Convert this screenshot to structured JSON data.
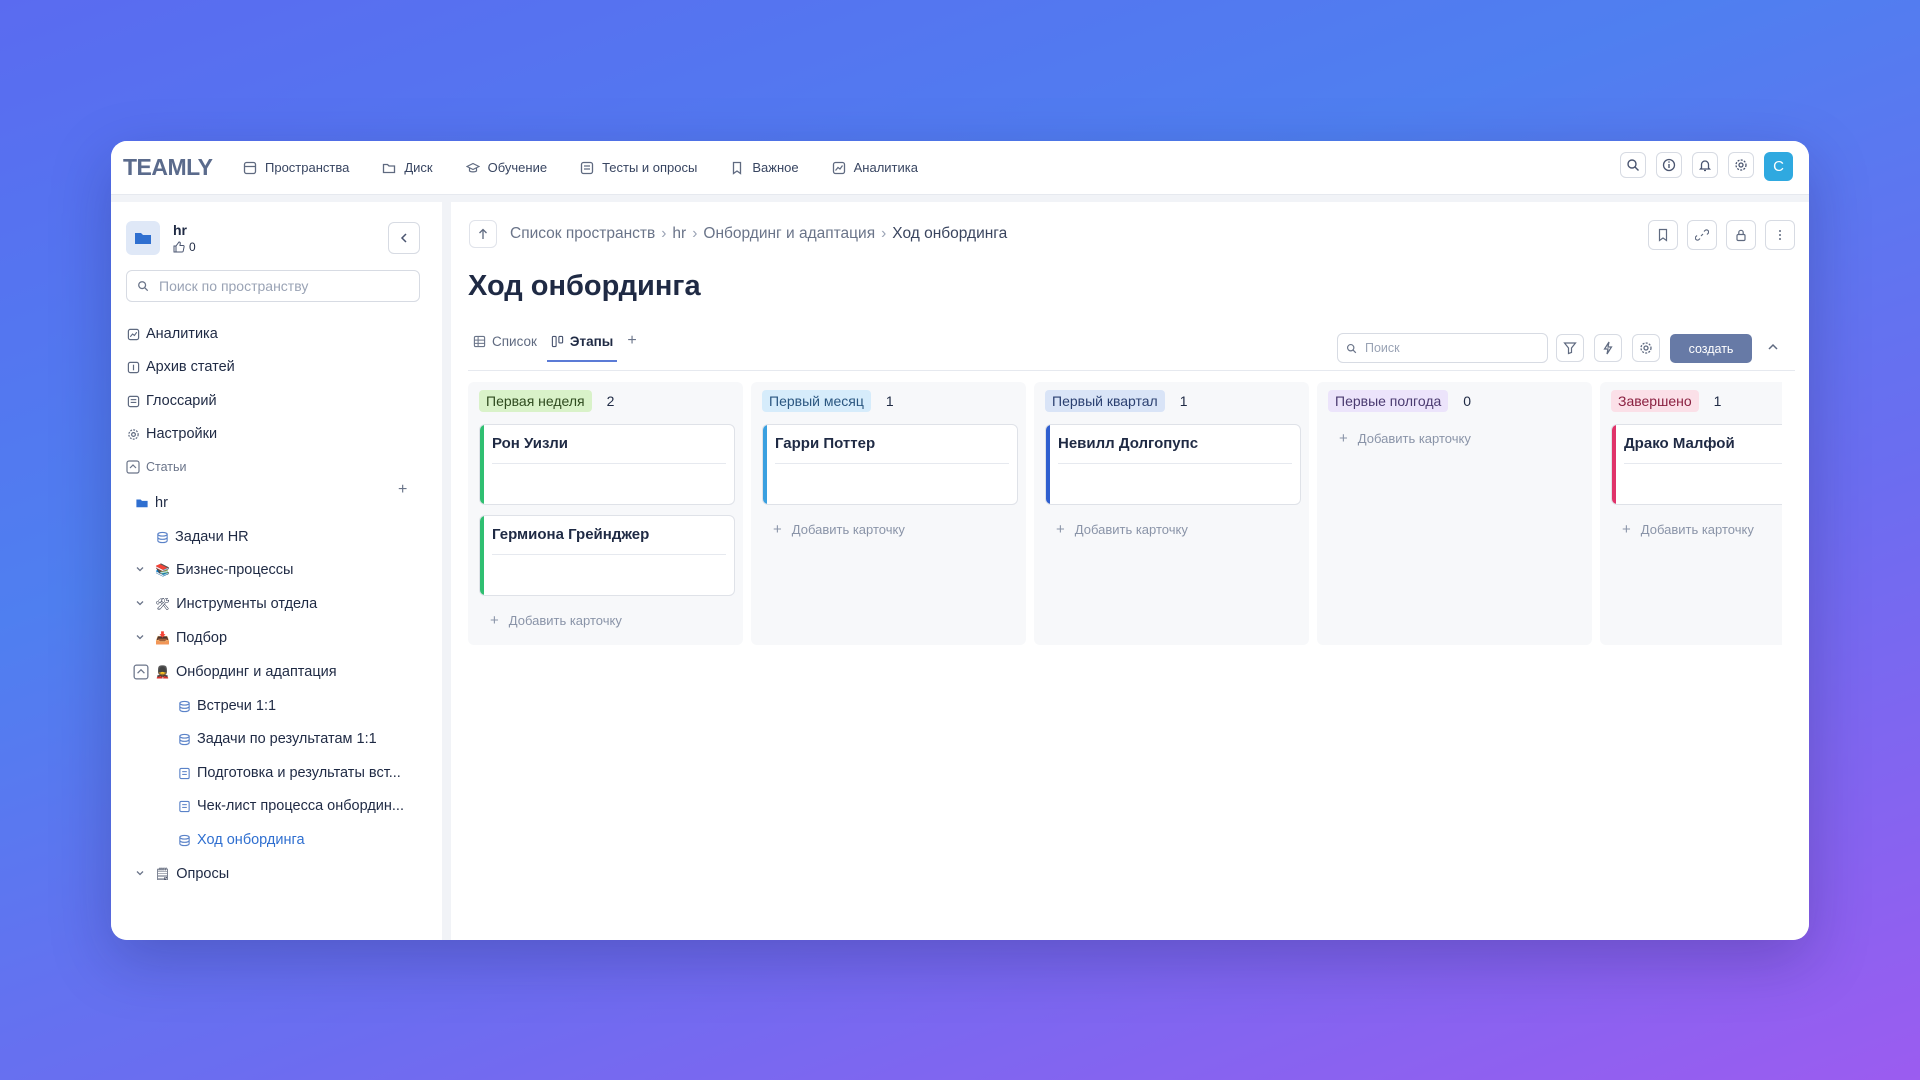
{
  "app": {
    "logo": "TEAMLY",
    "nav": [
      {
        "label": "Пространства",
        "icon": "spaces-icon"
      },
      {
        "label": "Диск",
        "icon": "folder-icon"
      },
      {
        "label": "Обучение",
        "icon": "graduation-icon"
      },
      {
        "label": "Тесты и опросы",
        "icon": "tests-icon"
      },
      {
        "label": "Важное",
        "icon": "bookmark-icon"
      },
      {
        "label": "Аналитика",
        "icon": "analytics-icon"
      }
    ],
    "user_initial": "C"
  },
  "sidebar": {
    "space_name": "hr",
    "likes": "0",
    "search_placeholder": "Поиск по пространству",
    "menu": [
      {
        "label": "Аналитика"
      },
      {
        "label": "Архив статей"
      },
      {
        "label": "Глоссарий"
      },
      {
        "label": "Настройки"
      }
    ],
    "section_label": "Статьи",
    "tree": [
      {
        "label": "hr"
      },
      {
        "label": "Задачи HR"
      },
      {
        "label": "Бизнес-процессы"
      },
      {
        "label": "Инструменты отдела"
      },
      {
        "label": "Подбор"
      },
      {
        "label": "Онбординг и адаптация"
      },
      {
        "label": "Встречи 1:1"
      },
      {
        "label": "Задачи по результатам 1:1"
      },
      {
        "label": "Подготовка и результаты вст..."
      },
      {
        "label": "Чек-лист процесса онбордин..."
      },
      {
        "label": "Ход онбординга"
      },
      {
        "label": "Опросы"
      }
    ]
  },
  "main": {
    "breadcrumb": [
      "Список пространств",
      "hr",
      "Онбординг и адаптация",
      "Ход онбординга"
    ],
    "title": "Ход онбординга",
    "tabs": [
      {
        "label": "Список"
      },
      {
        "label": "Этапы"
      }
    ],
    "search_placeholder": "Поиск",
    "create_label": "создать",
    "add_card_label": "Добавить карточку"
  },
  "board": {
    "columns": [
      {
        "name": "Первая неделя",
        "count": "2",
        "badge_bg": "#d9f2c9",
        "badge_fg": "#2e4a1e",
        "accent": "#2fbf71",
        "cards": [
          {
            "title": "Рон Уизли"
          },
          {
            "title": "Гермиона Грейнджер"
          }
        ]
      },
      {
        "name": "Первый месяц",
        "count": "1",
        "badge_bg": "#d6ecfb",
        "badge_fg": "#2a5680",
        "accent": "#3aa0e0",
        "cards": [
          {
            "title": "Гарри Поттер"
          }
        ]
      },
      {
        "name": "Первый квартал",
        "count": "1",
        "badge_bg": "#d9e4f7",
        "badge_fg": "#2a3f70",
        "accent": "#2f5fcf",
        "cards": [
          {
            "title": "Невилл Долгопупс"
          }
        ]
      },
      {
        "name": "Первые полгода",
        "count": "0",
        "badge_bg": "#ece4fb",
        "badge_fg": "#4a3a70",
        "accent": "#8a6fe0",
        "cards": []
      },
      {
        "name": "Завершено",
        "count": "1",
        "badge_bg": "#fbe0e8",
        "badge_fg": "#8a2040",
        "accent": "#e0336a",
        "cards": [
          {
            "title": "Драко Малфой"
          }
        ]
      }
    ]
  }
}
